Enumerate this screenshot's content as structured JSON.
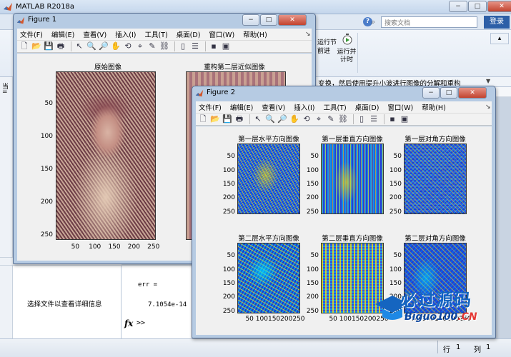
{
  "app": {
    "title": "MATLAB R2018a",
    "search_placeholder": "搜索文档",
    "login_label": "登录",
    "run_section_label": "运行节\n前进",
    "run_time_label": "运行并\n计时",
    "path_text": "变换，然后使用提升小波进行图像的分解和重构",
    "window_buttons": [
      "−",
      "□",
      "✕"
    ]
  },
  "left_panel": {
    "details_hint": "选择文件以查看详细信息",
    "strip_chars": [
      "当",
      "=",
      "详"
    ]
  },
  "command_window": {
    "output_var": "err =",
    "output_value": "7.1054e-14",
    "prompt": ">>",
    "fx_symbol": "fx"
  },
  "status_bar": {
    "row_label": "行",
    "row_value": "1",
    "col_label": "列",
    "col_value": "1"
  },
  "figure_menu": [
    "文件(F)",
    "编辑(E)",
    "查看(V)",
    "插入(I)",
    "工具(T)",
    "桌面(D)",
    "窗口(W)",
    "帮助(H)"
  ],
  "toolbar_icons": [
    "new-file-icon",
    "open-folder-icon",
    "save-icon",
    "print-icon",
    "pointer-icon",
    "zoom-in-icon",
    "zoom-out-icon",
    "pan-icon",
    "rotate-icon",
    "data-cursor-icon",
    "brush-icon",
    "link-icon",
    "colorbar-icon",
    "legend-icon",
    "hide-plot-tools-icon",
    "show-plot-tools-icon"
  ],
  "figure1": {
    "title": "Figure 1",
    "window_buttons": [
      "−",
      "□",
      "✕"
    ],
    "axes": [
      {
        "title": "原始图像",
        "yticks": [
          "50",
          "100",
          "150",
          "200",
          "250"
        ],
        "xticks": [
          "50",
          "100",
          "150",
          "200",
          "250"
        ]
      },
      {
        "title": "重构第二层近似图像",
        "yticks": [],
        "xticks": []
      }
    ]
  },
  "figure2": {
    "title": "Figure 2",
    "window_buttons": [
      "−",
      "□",
      "✕"
    ],
    "axes": [
      {
        "title": "第一层水平方向图像",
        "yticks": [
          "50",
          "100",
          "150",
          "200",
          "250"
        ],
        "xticks": []
      },
      {
        "title": "第一层垂直方向图像",
        "yticks": [
          "50",
          "100",
          "150",
          "200",
          "250"
        ],
        "xticks": []
      },
      {
        "title": "第一层对角方向图像",
        "yticks": [
          "50",
          "100",
          "150",
          "200",
          "250"
        ],
        "xticks": []
      },
      {
        "title": "第二层水平方向图像",
        "yticks": [
          "50",
          "100",
          "150",
          "200",
          "250"
        ],
        "xticks": [
          "50",
          "100",
          "150",
          "200",
          "250"
        ]
      },
      {
        "title": "第二层垂直方向图像",
        "yticks": [
          "50",
          "100",
          "150",
          "200",
          "250"
        ],
        "xticks": [
          "50",
          "100",
          "150",
          "200",
          "250"
        ]
      },
      {
        "title": "第二层对角方向图像",
        "yticks": [
          "50",
          "100",
          "150",
          "200",
          "250"
        ],
        "xticks": [
          "50",
          "100",
          "150",
          "200",
          "250"
        ]
      }
    ]
  },
  "watermark": {
    "cn_text": "必过源码",
    "en_text": "Biguo100",
    "en_suffix": ".CN"
  }
}
